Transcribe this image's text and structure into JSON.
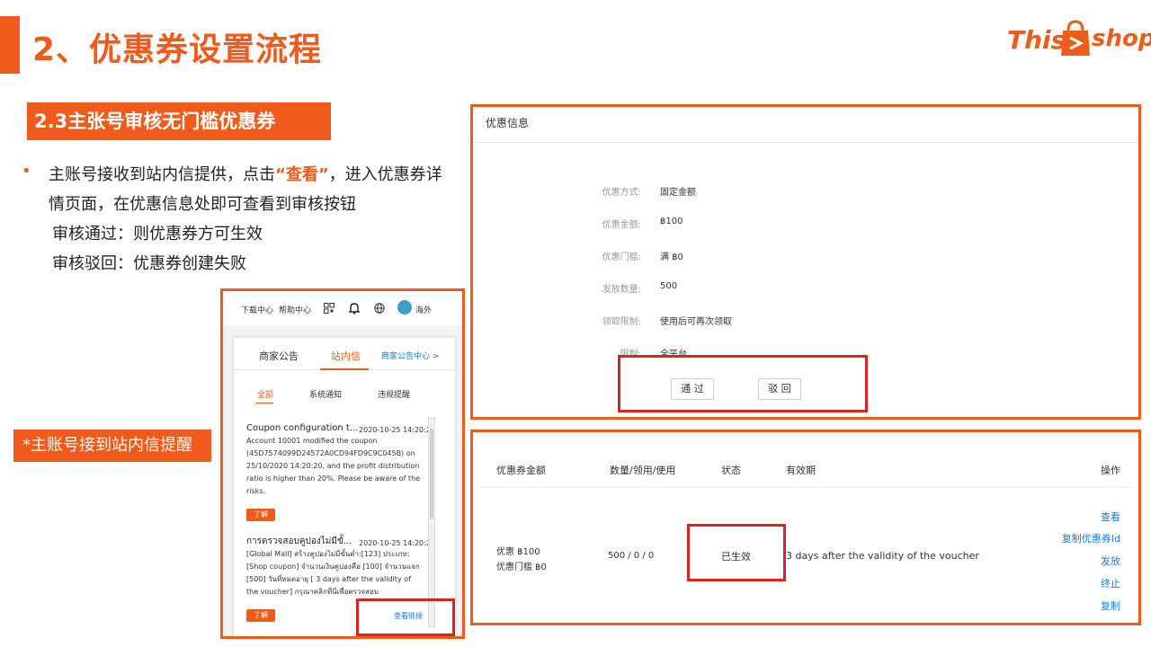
{
  "slide": {
    "title": "2、优惠券设置流程",
    "section": "2.3主张号审核无门槛优惠券",
    "note": "*主账号接到站内信提醒",
    "desc": {
      "line1_pre": "主账号接收到站内信提供，点击",
      "line1_hl": "“查看”",
      "line1_post": "，进入优惠券详",
      "line2": "情页面，在优惠信息处即可查看到审核按钮",
      "line3": "审核通过：则优惠券方可生效",
      "line4": "审核驳回：优惠券创建失败"
    }
  },
  "logo": {
    "left": "This",
    "right": "shop"
  },
  "phone": {
    "topbar": {
      "download": "下载中心",
      "help": "帮助中心",
      "region": "海外"
    },
    "tabs": {
      "announce": "商家公告",
      "inbox": "站内信",
      "more": "商家公告中心 >"
    },
    "subtabs": {
      "all": "全部",
      "system": "系统通知",
      "violation": "违规提醒"
    },
    "messages": [
      {
        "title": "Coupon configuration t...",
        "date": "2020-10-25 14:20:20",
        "body": "Account 10001 modified the coupon (45D7574099D24572A0CD94FD9C9C045B) on 25/10/2020 14:20:20, and the profit distribution ratio is higher than 20%. Please be aware of the risks.",
        "badge": "了解"
      },
      {
        "title": "การตรวจสอบคูปองไม่มีขั้...",
        "date": "2020-10-25 14:20:20",
        "body": "[Global Mall] สร้างคูปองไม่มีขั้นต่ำ:[123] ประเภท:[Shop coupon] จำนวนเงินคูปองคือ [100] จำนวนแจก [500] วันที่หมดอายุ [ 3 days after the validity of the voucher] กรุณาคลิกที่นี่เพื่อตรวจสอบ",
        "badge": "了解",
        "link": "查看链接"
      }
    ]
  },
  "info": {
    "header": "优惠信息",
    "rows": [
      {
        "label": "优惠方式:",
        "value": "固定金额"
      },
      {
        "label": "优惠金额:",
        "value": "฿100"
      },
      {
        "label": "优惠门槛:",
        "value": "满 ฿0"
      },
      {
        "label": "发放数量:",
        "value": "500"
      },
      {
        "label": "领取限制:",
        "value": "使用后可再次领取"
      },
      {
        "label": "限制:",
        "value": "全平台"
      }
    ],
    "approve": "通 过",
    "reject": "驳 回"
  },
  "table": {
    "headers": {
      "amount": "优惠券金额",
      "qty": "数量/领用/使用",
      "status": "状态",
      "validity": "有效期",
      "ops": "操作"
    },
    "row": {
      "amount1": "优惠 ฿100",
      "amount2": "优惠门槛 ฿0",
      "qty": "500 / 0 / 0",
      "status": "已生效",
      "validity": "3 days after the validity of the voucher"
    },
    "ops": [
      "查看",
      "复制优惠券Id",
      "发放",
      "终止",
      "复制"
    ]
  },
  "colors": {
    "brand": "#f05a1a",
    "highlight_box": "#d9261c",
    "link": "#1a7ad8"
  }
}
